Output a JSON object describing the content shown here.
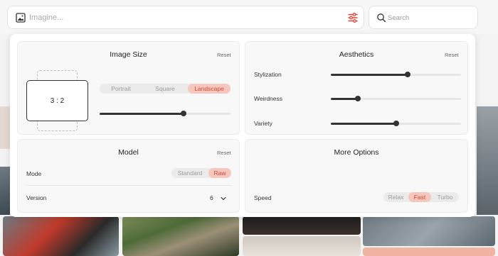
{
  "prompt": {
    "placeholder": "Imagine..."
  },
  "search": {
    "placeholder": "Search"
  },
  "image_size": {
    "title": "Image Size",
    "reset": "Reset",
    "ratio": "3 : 2",
    "orientations": [
      "Portrait",
      "Square",
      "Landscape"
    ],
    "selected_orientation": "Landscape",
    "size_slider": 0.64
  },
  "aesthetics": {
    "title": "Aesthetics",
    "reset": "Reset",
    "sliders": [
      {
        "label": "Stylization",
        "value": 0.59
      },
      {
        "label": "Weirdness",
        "value": 0.21
      },
      {
        "label": "Variety",
        "value": 0.5
      }
    ]
  },
  "model": {
    "title": "Model",
    "reset": "Reset",
    "mode_label": "Mode",
    "modes": [
      "Standard",
      "Raw"
    ],
    "selected_mode": "Raw",
    "version_label": "Version",
    "version_value": "6"
  },
  "more_options": {
    "title": "More Options",
    "speed_label": "Speed",
    "speeds": [
      "Relax",
      "Fast",
      "Turbo"
    ],
    "selected_speed": "Fast"
  },
  "colors": {
    "accent_bg": "#f6c7bd",
    "accent_text": "#d0463a",
    "settings_icon": "#e0443a"
  }
}
